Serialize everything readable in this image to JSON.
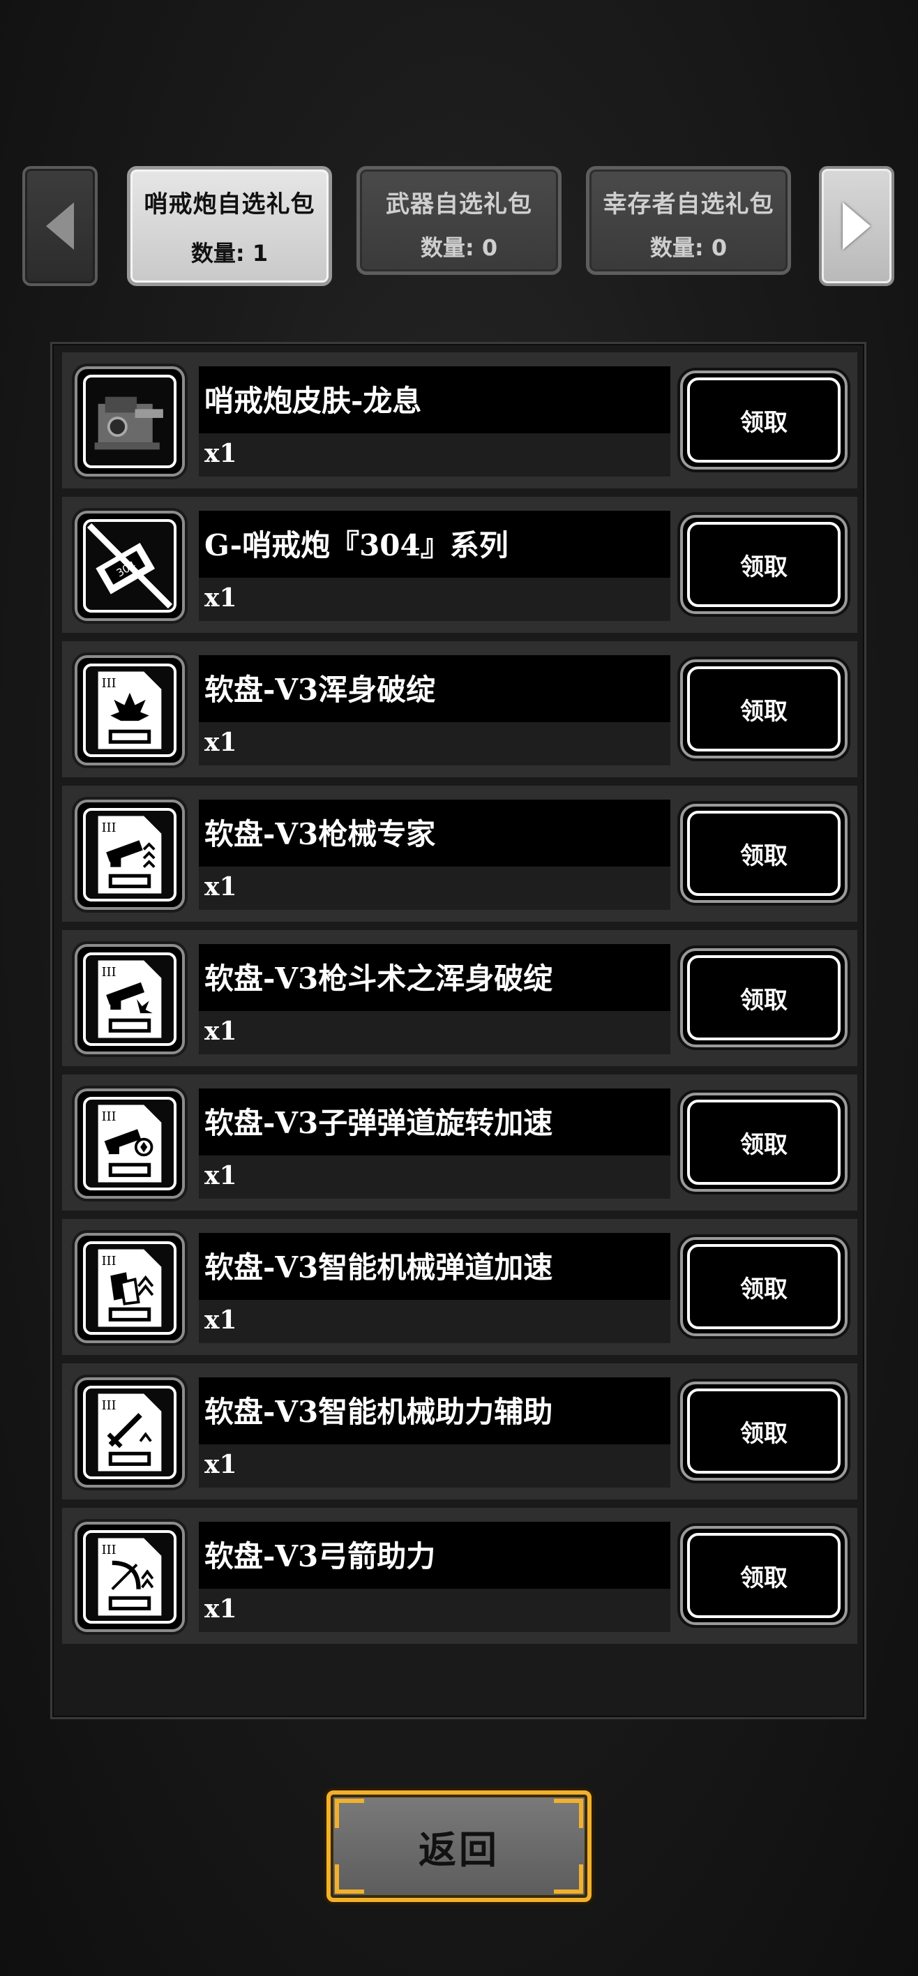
{
  "tabs": [
    {
      "title": "哨戒炮自选礼包",
      "count": "数量: 1",
      "active": true
    },
    {
      "title": "武器自选礼包",
      "count": "数量: 0",
      "active": false
    },
    {
      "title": "幸存者自选礼包",
      "count": "数量: 0",
      "active": false
    }
  ],
  "nav": {
    "prev_icon": "triangle-left",
    "next_icon": "triangle-right"
  },
  "items": [
    {
      "name": "哨戒炮皮肤-龙息",
      "qty": "x1",
      "icon": "turret-skin-icon",
      "claim": "领取"
    },
    {
      "name": "G-哨戒炮『304』系列",
      "qty": "x1",
      "icon": "turret-304-icon",
      "claim": "领取"
    },
    {
      "name": "软盘-V3浑身破绽",
      "qty": "x1",
      "icon": "floppy-burst-icon",
      "claim": "领取"
    },
    {
      "name": "软盘-V3枪械专家",
      "qty": "x1",
      "icon": "floppy-gun-icon",
      "claim": "领取"
    },
    {
      "name": "软盘-V3枪斗术之浑身破绽",
      "qty": "x1",
      "icon": "floppy-gunfight-icon",
      "claim": "领取"
    },
    {
      "name": "软盘-V3子弹弹道旋转加速",
      "qty": "x1",
      "icon": "floppy-bullet-spin-icon",
      "claim": "领取"
    },
    {
      "name": "软盘-V3智能机械弹道加速",
      "qty": "x1",
      "icon": "floppy-smart-mech-icon",
      "claim": "领取"
    },
    {
      "name": "软盘-V3智能机械助力辅助",
      "qty": "x1",
      "icon": "floppy-sword-icon",
      "claim": "领取"
    },
    {
      "name": "软盘-V3弓箭助力",
      "qty": "x1",
      "icon": "floppy-bow-icon",
      "claim": "领取"
    }
  ],
  "back_label": "返回",
  "colors": {
    "accent_gold": "#f1b12c",
    "active_tab": "#dcdcdc",
    "inactive_tab": "#444444"
  }
}
